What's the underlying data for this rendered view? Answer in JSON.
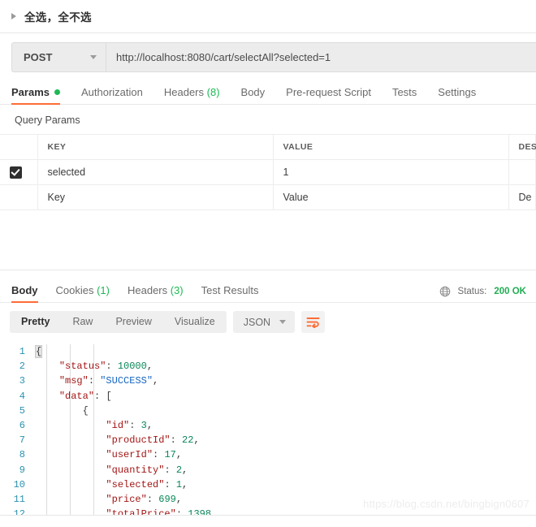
{
  "request_header": {
    "title": "全选，全不选",
    "caret_icon": "triangle-right-icon"
  },
  "url_bar": {
    "method": "POST",
    "method_caret_icon": "chevron-down-icon",
    "url": "http://localhost:8080/cart/selectAll?selected=1"
  },
  "request_tabs": [
    {
      "label": "Params",
      "badge": "",
      "dot": true,
      "active": true
    },
    {
      "label": "Authorization",
      "badge": "",
      "dot": false,
      "active": false
    },
    {
      "label": "Headers",
      "badge": "(8)",
      "dot": false,
      "active": false
    },
    {
      "label": "Body",
      "badge": "",
      "dot": false,
      "active": false
    },
    {
      "label": "Pre-request Script",
      "badge": "",
      "dot": false,
      "active": false
    },
    {
      "label": "Tests",
      "badge": "",
      "dot": false,
      "active": false
    },
    {
      "label": "Settings",
      "badge": "",
      "dot": false,
      "active": false
    }
  ],
  "query_params": {
    "section_title": "Query Params",
    "columns": [
      "KEY",
      "VALUE",
      "DES"
    ],
    "rows": [
      {
        "checked": true,
        "key": "selected",
        "value": "1",
        "description": ""
      }
    ],
    "new_row_placeholders": {
      "key": "Key",
      "value": "Value",
      "description": "De"
    }
  },
  "response": {
    "tabs": [
      {
        "label": "Body",
        "badge": "",
        "active": true
      },
      {
        "label": "Cookies",
        "badge": "(1)",
        "active": false
      },
      {
        "label": "Headers",
        "badge": "(3)",
        "active": false
      },
      {
        "label": "Test Results",
        "badge": "",
        "active": false
      }
    ],
    "globe_icon": "globe-icon",
    "status_label": "Status:",
    "status_value": "200 OK",
    "format_tabs": [
      {
        "label": "Pretty",
        "active": true
      },
      {
        "label": "Raw",
        "active": false
      },
      {
        "label": "Preview",
        "active": false
      },
      {
        "label": "Visualize",
        "active": false
      }
    ],
    "language": "JSON",
    "language_caret_icon": "chevron-down-icon",
    "wrap_icon": "wrap-text-icon"
  },
  "body_code": {
    "lines": [
      {
        "n": "1",
        "indent": 0,
        "tokens": [
          {
            "t": "{",
            "c": "brace-hl"
          }
        ]
      },
      {
        "n": "2",
        "indent": 1,
        "tokens": [
          {
            "t": "\"status\"",
            "c": "k"
          },
          {
            "t": ": ",
            "c": "p"
          },
          {
            "t": "10000",
            "c": "n"
          },
          {
            "t": ",",
            "c": "p"
          }
        ]
      },
      {
        "n": "3",
        "indent": 1,
        "tokens": [
          {
            "t": "\"msg\"",
            "c": "k"
          },
          {
            "t": ": ",
            "c": "p"
          },
          {
            "t": "\"SUCCESS\"",
            "c": "s"
          },
          {
            "t": ",",
            "c": "p"
          }
        ]
      },
      {
        "n": "4",
        "indent": 1,
        "tokens": [
          {
            "t": "\"data\"",
            "c": "k"
          },
          {
            "t": ": ",
            "c": "p"
          },
          {
            "t": "[",
            "c": "p"
          }
        ]
      },
      {
        "n": "5",
        "indent": 2,
        "tokens": [
          {
            "t": "{",
            "c": "p"
          }
        ]
      },
      {
        "n": "6",
        "indent": 3,
        "tokens": [
          {
            "t": "\"id\"",
            "c": "k"
          },
          {
            "t": ": ",
            "c": "p"
          },
          {
            "t": "3",
            "c": "n"
          },
          {
            "t": ",",
            "c": "p"
          }
        ]
      },
      {
        "n": "7",
        "indent": 3,
        "tokens": [
          {
            "t": "\"productId\"",
            "c": "k"
          },
          {
            "t": ": ",
            "c": "p"
          },
          {
            "t": "22",
            "c": "n"
          },
          {
            "t": ",",
            "c": "p"
          }
        ]
      },
      {
        "n": "8",
        "indent": 3,
        "tokens": [
          {
            "t": "\"userId\"",
            "c": "k"
          },
          {
            "t": ": ",
            "c": "p"
          },
          {
            "t": "17",
            "c": "n"
          },
          {
            "t": ",",
            "c": "p"
          }
        ]
      },
      {
        "n": "9",
        "indent": 3,
        "tokens": [
          {
            "t": "\"quantity\"",
            "c": "k"
          },
          {
            "t": ": ",
            "c": "p"
          },
          {
            "t": "2",
            "c": "n"
          },
          {
            "t": ",",
            "c": "p"
          }
        ]
      },
      {
        "n": "10",
        "indent": 3,
        "tokens": [
          {
            "t": "\"selected\"",
            "c": "k"
          },
          {
            "t": ": ",
            "c": "p"
          },
          {
            "t": "1",
            "c": "n"
          },
          {
            "t": ",",
            "c": "p"
          }
        ]
      },
      {
        "n": "11",
        "indent": 3,
        "tokens": [
          {
            "t": "\"price\"",
            "c": "k"
          },
          {
            "t": ": ",
            "c": "p"
          },
          {
            "t": "699",
            "c": "n"
          },
          {
            "t": ",",
            "c": "p"
          }
        ]
      },
      {
        "n": "12",
        "indent": 3,
        "tokens": [
          {
            "t": "\"totalPrice\"",
            "c": "k"
          },
          {
            "t": ": ",
            "c": "p"
          },
          {
            "t": "1398",
            "c": "n"
          },
          {
            "t": ",",
            "c": "p"
          }
        ]
      }
    ]
  },
  "watermark": "https://blog.csdn.net/bingbign0607",
  "colors": {
    "accent": "#ff6c37",
    "success": "#1db954",
    "status_ok": "#21ad54"
  }
}
